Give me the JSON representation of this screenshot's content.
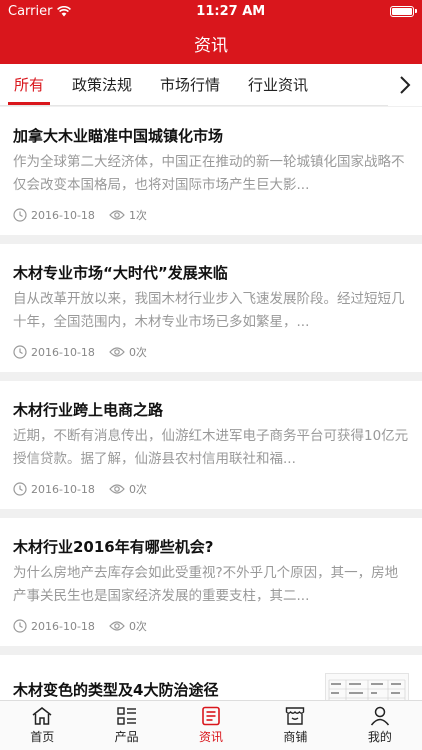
{
  "status": {
    "carrier": "Carrier",
    "time": "11:27 AM"
  },
  "header": {
    "title": "资讯"
  },
  "tabs": [
    {
      "label": "所有",
      "active": true
    },
    {
      "label": "政策法规"
    },
    {
      "label": "市场行情"
    },
    {
      "label": "行业资讯"
    }
  ],
  "articles": [
    {
      "title": "加拿大木业瞄准中国城镇化市场",
      "summary": "作为全球第二大经济体，中国正在推动的新一轮城镇化国家战略不仅会改变本国格局，也将对国际市场产生巨大影...",
      "date": "2016-10-18",
      "views": "1次"
    },
    {
      "title": "木材专业市场“大时代”发展来临",
      "summary": "自从改革开放以来，我国木材行业步入飞速发展阶段。经过短短几十年，全国范围内，木材专业市场已多如繁星，...",
      "date": "2016-10-18",
      "views": "0次"
    },
    {
      "title": "木材行业跨上电商之路",
      "summary": "近期，不断有消息传出，仙游红木进军电子商务平台可获得10亿元授信贷款。据了解，仙游县农村信用联社和福...",
      "date": "2016-10-18",
      "views": "0次"
    },
    {
      "title": "木材行业2016年有哪些机会?",
      "summary": "为什么房地产去库存会如此受重视?不外乎几个原因，其一，房地产事关民生也是国家经济发展的重要支柱，其二...",
      "date": "2016-10-18",
      "views": "0次"
    },
    {
      "title": "木材变色的类型及4大防治途径",
      "date": "2016-10-18",
      "views": "0次"
    }
  ],
  "bottom_nav": [
    {
      "label": "首页",
      "icon": "home-icon"
    },
    {
      "label": "产品",
      "icon": "grid-list-icon"
    },
    {
      "label": "资讯",
      "icon": "news-icon",
      "active": true
    },
    {
      "label": "商铺",
      "icon": "shop-icon"
    },
    {
      "label": "我的",
      "icon": "user-icon"
    }
  ],
  "colors": {
    "accent": "#d9161c"
  }
}
